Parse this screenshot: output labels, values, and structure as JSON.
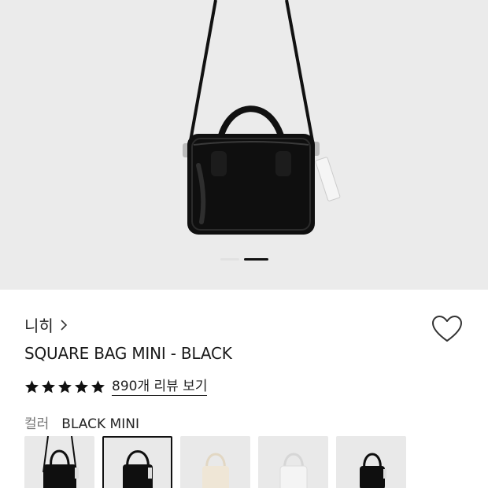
{
  "product": {
    "brand": "니히",
    "title": "SQUARE BAG MINI - BLACK",
    "rating_stars": 5,
    "review_link": "890개 리뷰 보기",
    "color_label": "컬러",
    "color_value": "BLACK MINI"
  },
  "gallery": {
    "image_count": 2,
    "active_index": 1
  },
  "swatches": [
    {
      "name": "black-mini-strap",
      "color": "#0f0f0f",
      "selected": false
    },
    {
      "name": "black-mini",
      "color": "#0f0f0f",
      "selected": true
    },
    {
      "name": "ivory-mini",
      "color": "#efe6d6",
      "selected": false
    },
    {
      "name": "white-mini",
      "color": "#f3f3f3",
      "selected": false
    },
    {
      "name": "black-mini-strap-alt",
      "color": "#0f0f0f",
      "selected": false
    }
  ],
  "colors": {
    "hero_bg": "#ebebeb",
    "bag": "#0f0f0f"
  },
  "icons": {
    "brand_chevron": "chevron-right-icon",
    "wishlist": "heart-outline-icon",
    "star": "star-filled-icon"
  }
}
